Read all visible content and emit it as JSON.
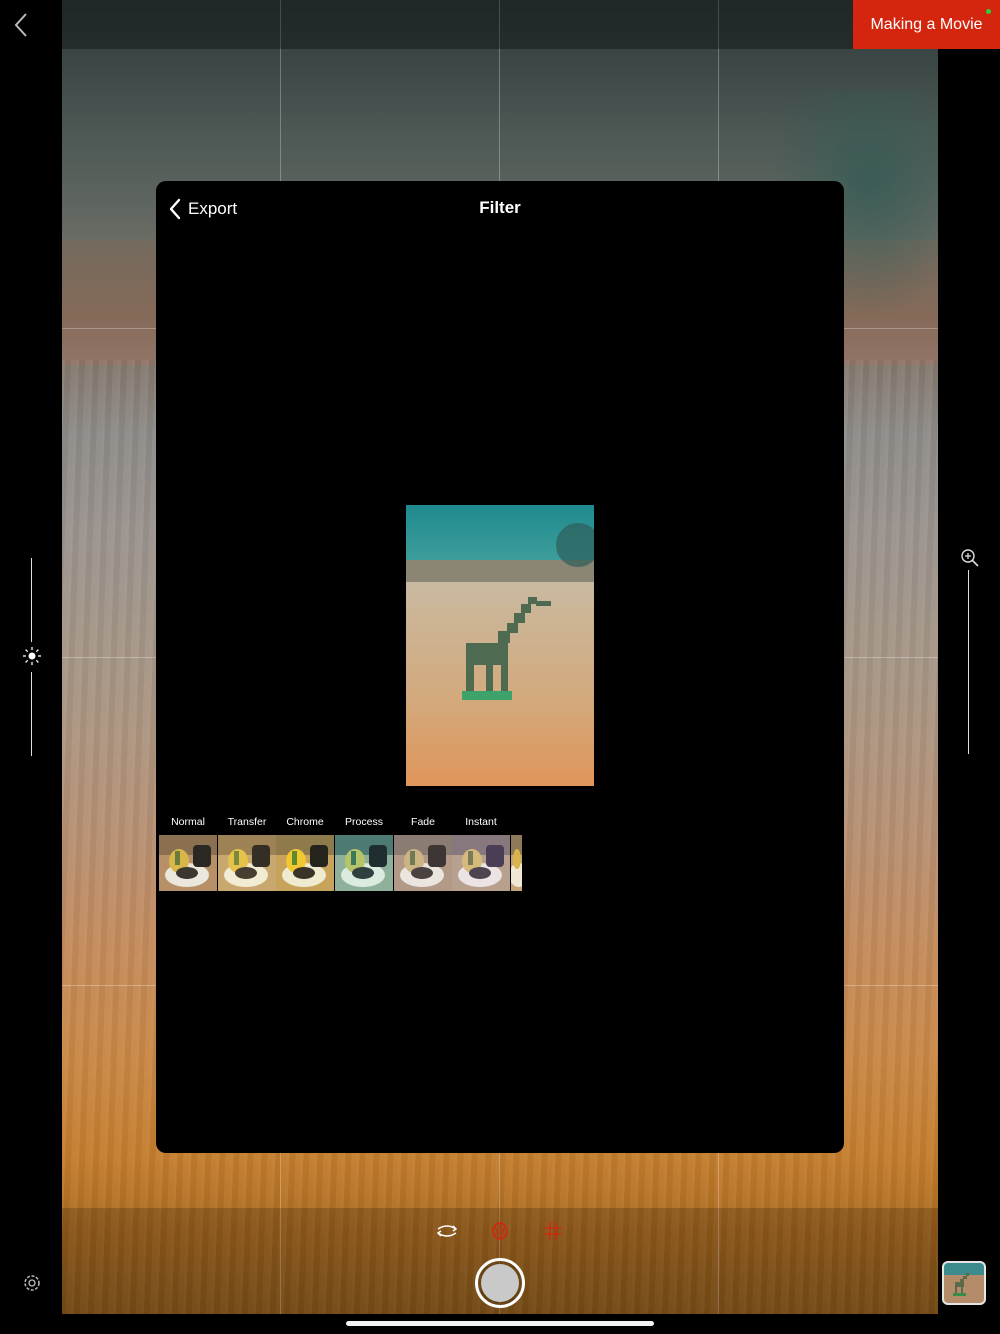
{
  "app": {
    "project_badge": "Making a Movie"
  },
  "sheet": {
    "back_label": "Export",
    "title": "Filter"
  },
  "filters": [
    {
      "label": "Normal"
    },
    {
      "label": "Transfer"
    },
    {
      "label": "Chrome"
    },
    {
      "label": "Process"
    },
    {
      "label": "Fade"
    },
    {
      "label": "Instant"
    }
  ],
  "colors": {
    "accent_red": "#d4260e",
    "status_green": "#2ad13a",
    "sheet_background": "#000000"
  },
  "icons": {
    "back": "chevron-left-icon",
    "exposure": "sun-icon",
    "zoom": "zoom-in-icon",
    "settings": "gear-icon",
    "switch_camera": "switch-camera-icon",
    "filter_mode": "filter-icon",
    "grid": "grid-icon"
  }
}
